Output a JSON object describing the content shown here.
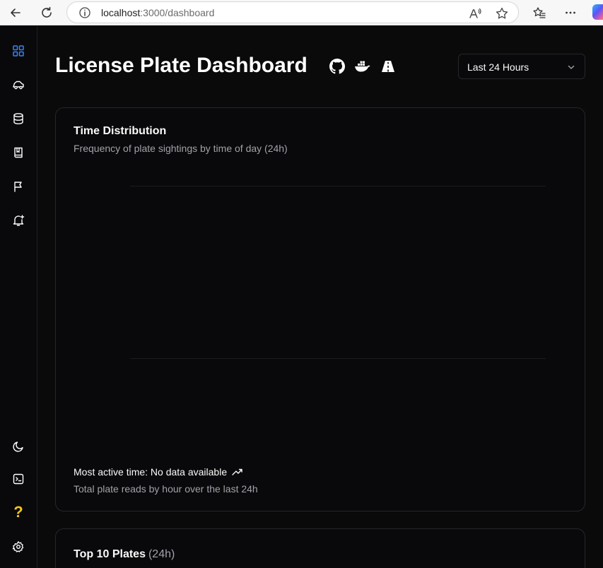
{
  "browser": {
    "url_host": "localhost",
    "url_rest": ":3000/dashboard"
  },
  "sidebar": {
    "items": [
      {
        "icon": "dashboard-grid-icon",
        "active": true
      },
      {
        "icon": "car-icon"
      },
      {
        "icon": "database-icon"
      },
      {
        "icon": "book-icon"
      },
      {
        "icon": "flag-icon"
      },
      {
        "icon": "bell-plus-icon"
      }
    ],
    "bottom": [
      {
        "icon": "moon-icon"
      },
      {
        "icon": "terminal-icon"
      },
      {
        "icon": "help-icon",
        "label": "?"
      },
      {
        "icon": "gear-icon"
      }
    ]
  },
  "header": {
    "title": "License Plate Dashboard",
    "icons": [
      "github-icon",
      "docker-icon",
      "road-icon"
    ],
    "range_select": {
      "value": "Last 24 Hours"
    }
  },
  "time_card": {
    "title": "Time Distribution",
    "description": "Frequency of plate sightings by time of day (24h)",
    "footer_primary": "Most active time: No data available",
    "footer_secondary": "Total plate reads by hour over the last 24h"
  },
  "plates_card": {
    "title": "Top 10 Plates",
    "suffix": "(24h)"
  },
  "colors": {
    "background": "#0a0a0b",
    "border": "#27272a",
    "accent": "#3b82f6",
    "help": "#f5c518",
    "muted_text": "#a1a1aa"
  }
}
